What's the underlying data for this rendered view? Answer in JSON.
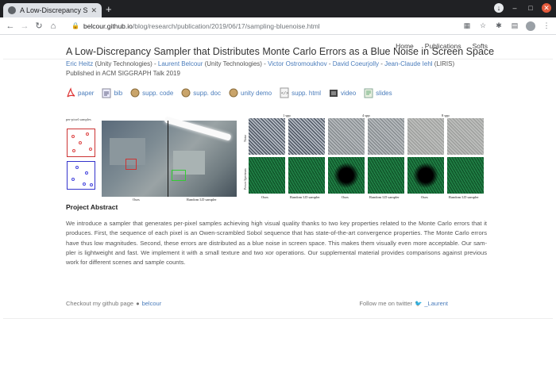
{
  "browser": {
    "tab_title": "A Low-Discrepancy Sampl",
    "url_host": "belcour.github.io",
    "url_path": "/blog/research/publication/2019/06/17/sampling-bluenoise.html"
  },
  "nav": {
    "home": "Home",
    "publications": "Publications",
    "softs": "Softs"
  },
  "paper": {
    "title": "A Low-Discrepancy Sampler that Distributes Monte Carlo Errors as a Blue Noise in Screen Space",
    "authors": [
      {
        "name": "Eric Heitz",
        "aff": " (Unity Technologies)",
        "sep": " - "
      },
      {
        "name": "Laurent Belcour",
        "aff": " (Unity Technologies)",
        "sep": " - "
      },
      {
        "name": "Victor Ostromoukhov",
        "aff": "",
        "sep": " - "
      },
      {
        "name": "David Coeurjolly",
        "aff": "",
        "sep": " - "
      },
      {
        "name": "Jean-Claude Iehl",
        "aff": " (LIRIS)",
        "sep": ""
      }
    ],
    "published": "Published in ACM SIGGRAPH Talk 2019"
  },
  "links": [
    "paper",
    "bib",
    "supp. code",
    "supp. doc",
    "unity demo",
    "supp. html",
    "video",
    "slides"
  ],
  "figure": {
    "pps": "per-pixel samples",
    "ours": "Ours",
    "random": "Random LD sampler",
    "spp": [
      "1 spp",
      "4 spp",
      "8 spp"
    ],
    "row_render": "Noise",
    "row_spectrum": "Power Spectrum"
  },
  "abstract": {
    "heading": "Project Abstract",
    "text": "We introduce a sampler that generates per-pixel samples achieving high visual quality thanks to two key properties related to the Monte Carlo errors that it produces. First, the sequence of each pixel is an Owen-scrambled Sobol sequence that has state-of-the-art convergence properties. The Monte Carlo errors have thus low magnitudes. Second, these errors are distributed as a blue noise in screen space. This makes them visually even more acceptable. Our sam-pler is lightweight and fast. We implement it with a small texture and two xor operations. Our supplemental material provides comparisons against previous work for different scenes and sample counts."
  },
  "footer": {
    "github_prefix": "Checkout my github page",
    "github_user": "belcour",
    "twitter_prefix": "Follow me on twitter",
    "twitter_user": "_Laurent"
  }
}
